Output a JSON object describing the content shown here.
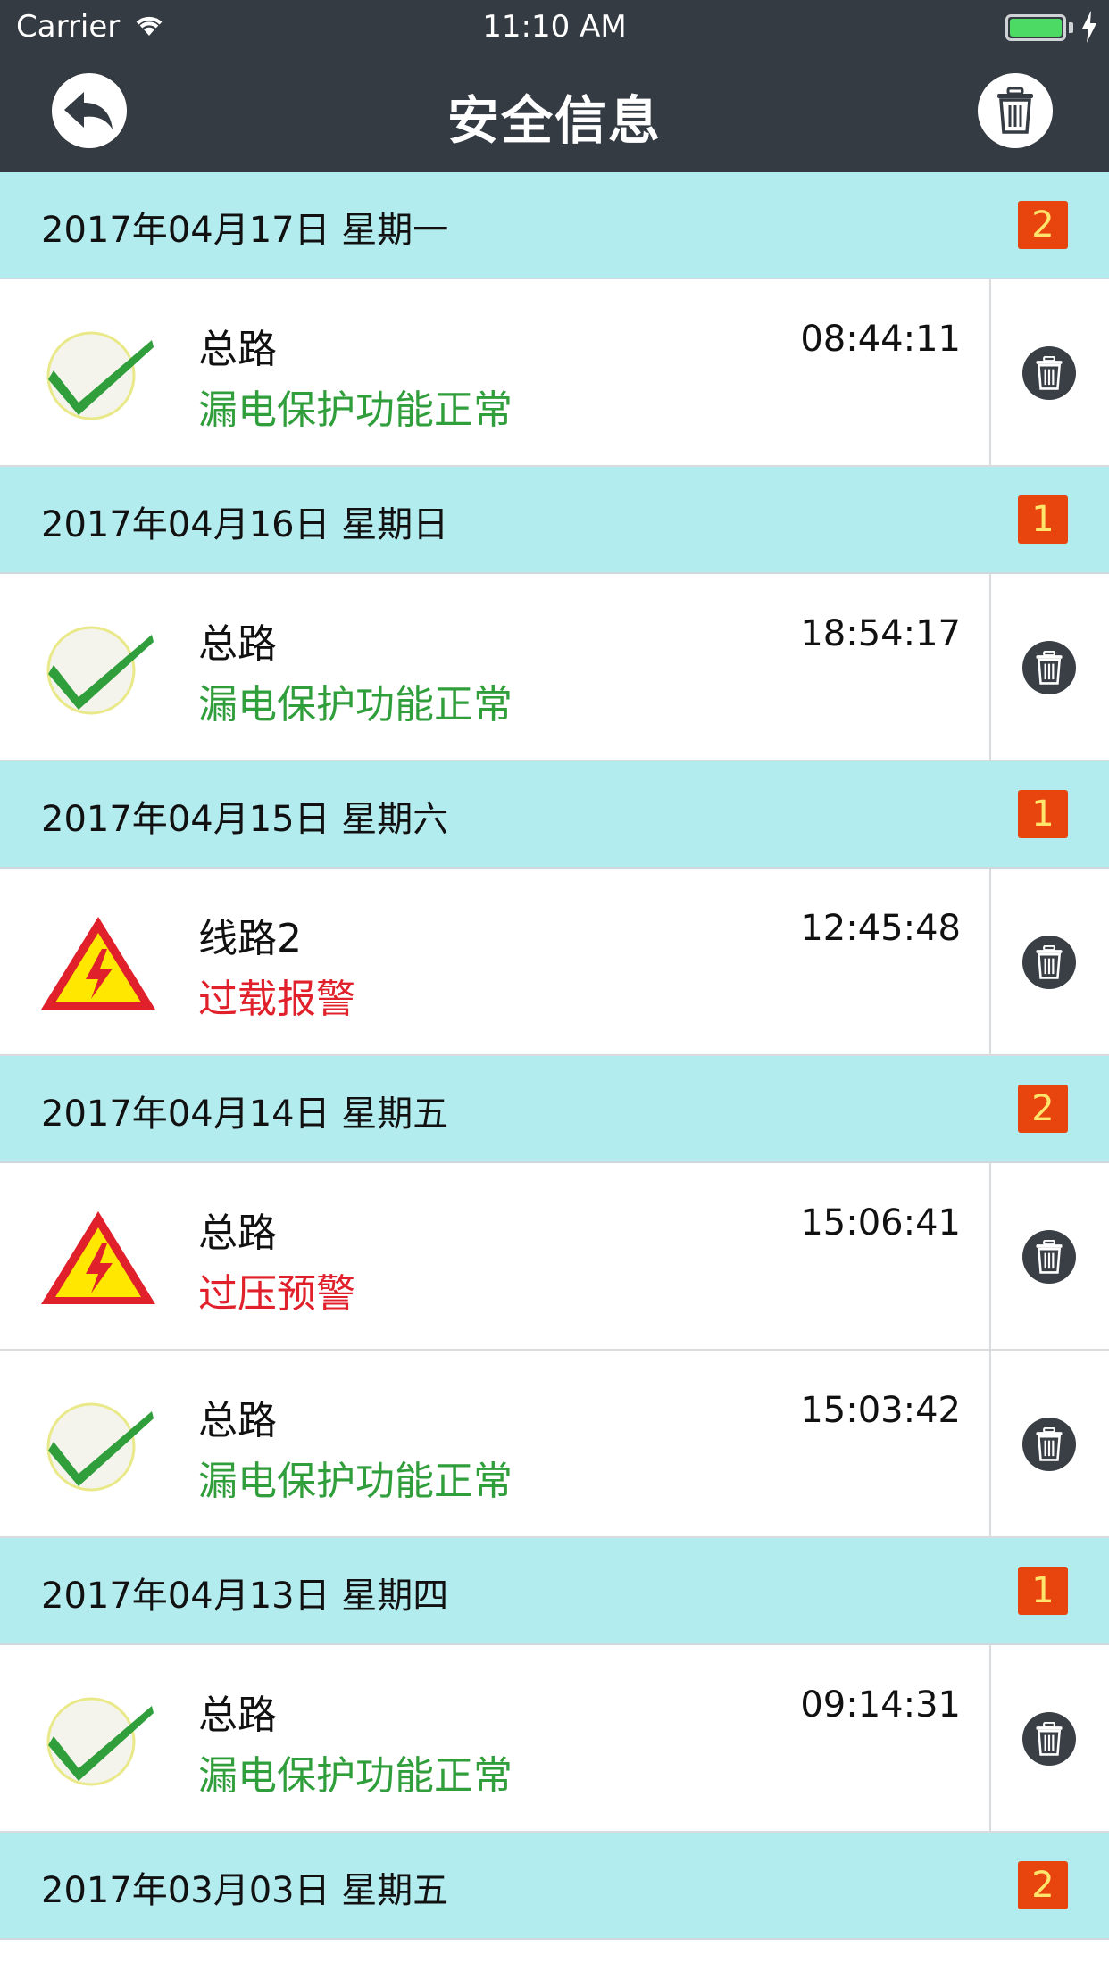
{
  "status_bar": {
    "carrier": "Carrier",
    "time": "11:10 AM"
  },
  "nav": {
    "title": "安全信息"
  },
  "colors": {
    "nav_bg": "#353b43",
    "section_bg": "#b3ecef",
    "badge_bg": "#e8440e",
    "badge_text": "#ffe56b",
    "ok_text": "#2f9e3b",
    "alarm_text": "#e0202a"
  },
  "sections": [
    {
      "date": "2017年04月17日 星期一",
      "count": "2",
      "items": [
        {
          "icon": "check-icon",
          "name": "总路",
          "status": "漏电保护功能正常",
          "time": "08:44:11"
        }
      ]
    },
    {
      "date": "2017年04月16日 星期日",
      "count": "1",
      "items": [
        {
          "icon": "check-icon",
          "name": "总路",
          "status": "漏电保护功能正常",
          "time": "18:54:17"
        }
      ]
    },
    {
      "date": "2017年04月15日 星期六",
      "count": "1",
      "items": [
        {
          "icon": "warning-icon",
          "name": "线路2",
          "status": "过载报警",
          "time": "12:45:48"
        }
      ]
    },
    {
      "date": "2017年04月14日 星期五",
      "count": "2",
      "items": [
        {
          "icon": "warning-icon",
          "name": "总路",
          "status": "过压预警",
          "time": "15:06:41"
        },
        {
          "icon": "check-icon",
          "name": "总路",
          "status": "漏电保护功能正常",
          "time": "15:03:42"
        }
      ]
    },
    {
      "date": "2017年04月13日 星期四",
      "count": "1",
      "items": [
        {
          "icon": "check-icon",
          "name": "总路",
          "status": "漏电保护功能正常",
          "time": "09:14:31"
        }
      ]
    },
    {
      "date": "2017年03月03日 星期五",
      "count": "2",
      "items": []
    }
  ]
}
